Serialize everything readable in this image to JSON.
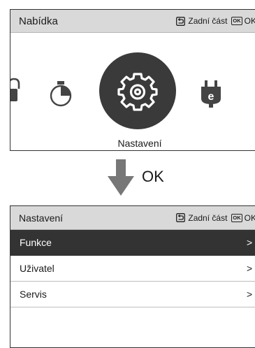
{
  "top_panel": {
    "title": "Nabídka",
    "back_label": "Zadní část",
    "ok_icon_text": "OK",
    "ok_label": "OK",
    "selected_label": "Nastavení",
    "icons": [
      "lock-icon",
      "timer-icon",
      "gear-icon",
      "energy-plug-icon",
      "item-partial-icon"
    ]
  },
  "transition": {
    "label": "OK"
  },
  "bottom_panel": {
    "title": "Nastavení",
    "back_label": "Zadní část",
    "ok_icon_text": "OK",
    "ok_label": "OK",
    "items": [
      {
        "label": "Funkce",
        "chevron": ">",
        "selected": true
      },
      {
        "label": "Uživatel",
        "chevron": ">",
        "selected": false
      },
      {
        "label": "Servis",
        "chevron": ">",
        "selected": false
      }
    ]
  },
  "colors": {
    "header_bg": "#d9d9d9",
    "selected_bg": "#333333",
    "arrow": "#777777"
  }
}
